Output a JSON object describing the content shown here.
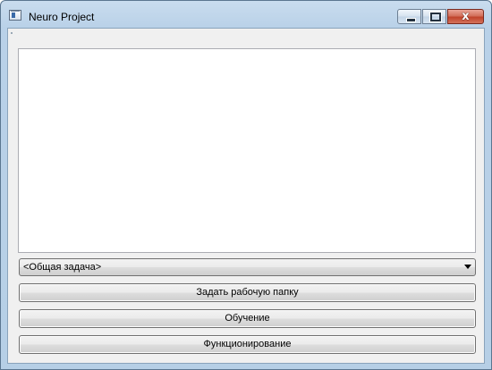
{
  "window": {
    "title": "Neuro Project",
    "icon": "app-window-icon"
  },
  "controls": {
    "minimize_icon": "minimize-icon",
    "maximize_icon": "maximize-icon",
    "close_glyph": "x"
  },
  "output": {
    "text": ""
  },
  "task_select": {
    "value": "<Общая задача>"
  },
  "buttons": {
    "set_workdir": "Задать рабочую папку",
    "training": "Обучение",
    "operation": "Функционирование"
  },
  "colors": {
    "titlebar": "#b9d1e8",
    "close_button": "#c0432b",
    "client_background": "#f0f0f0"
  }
}
